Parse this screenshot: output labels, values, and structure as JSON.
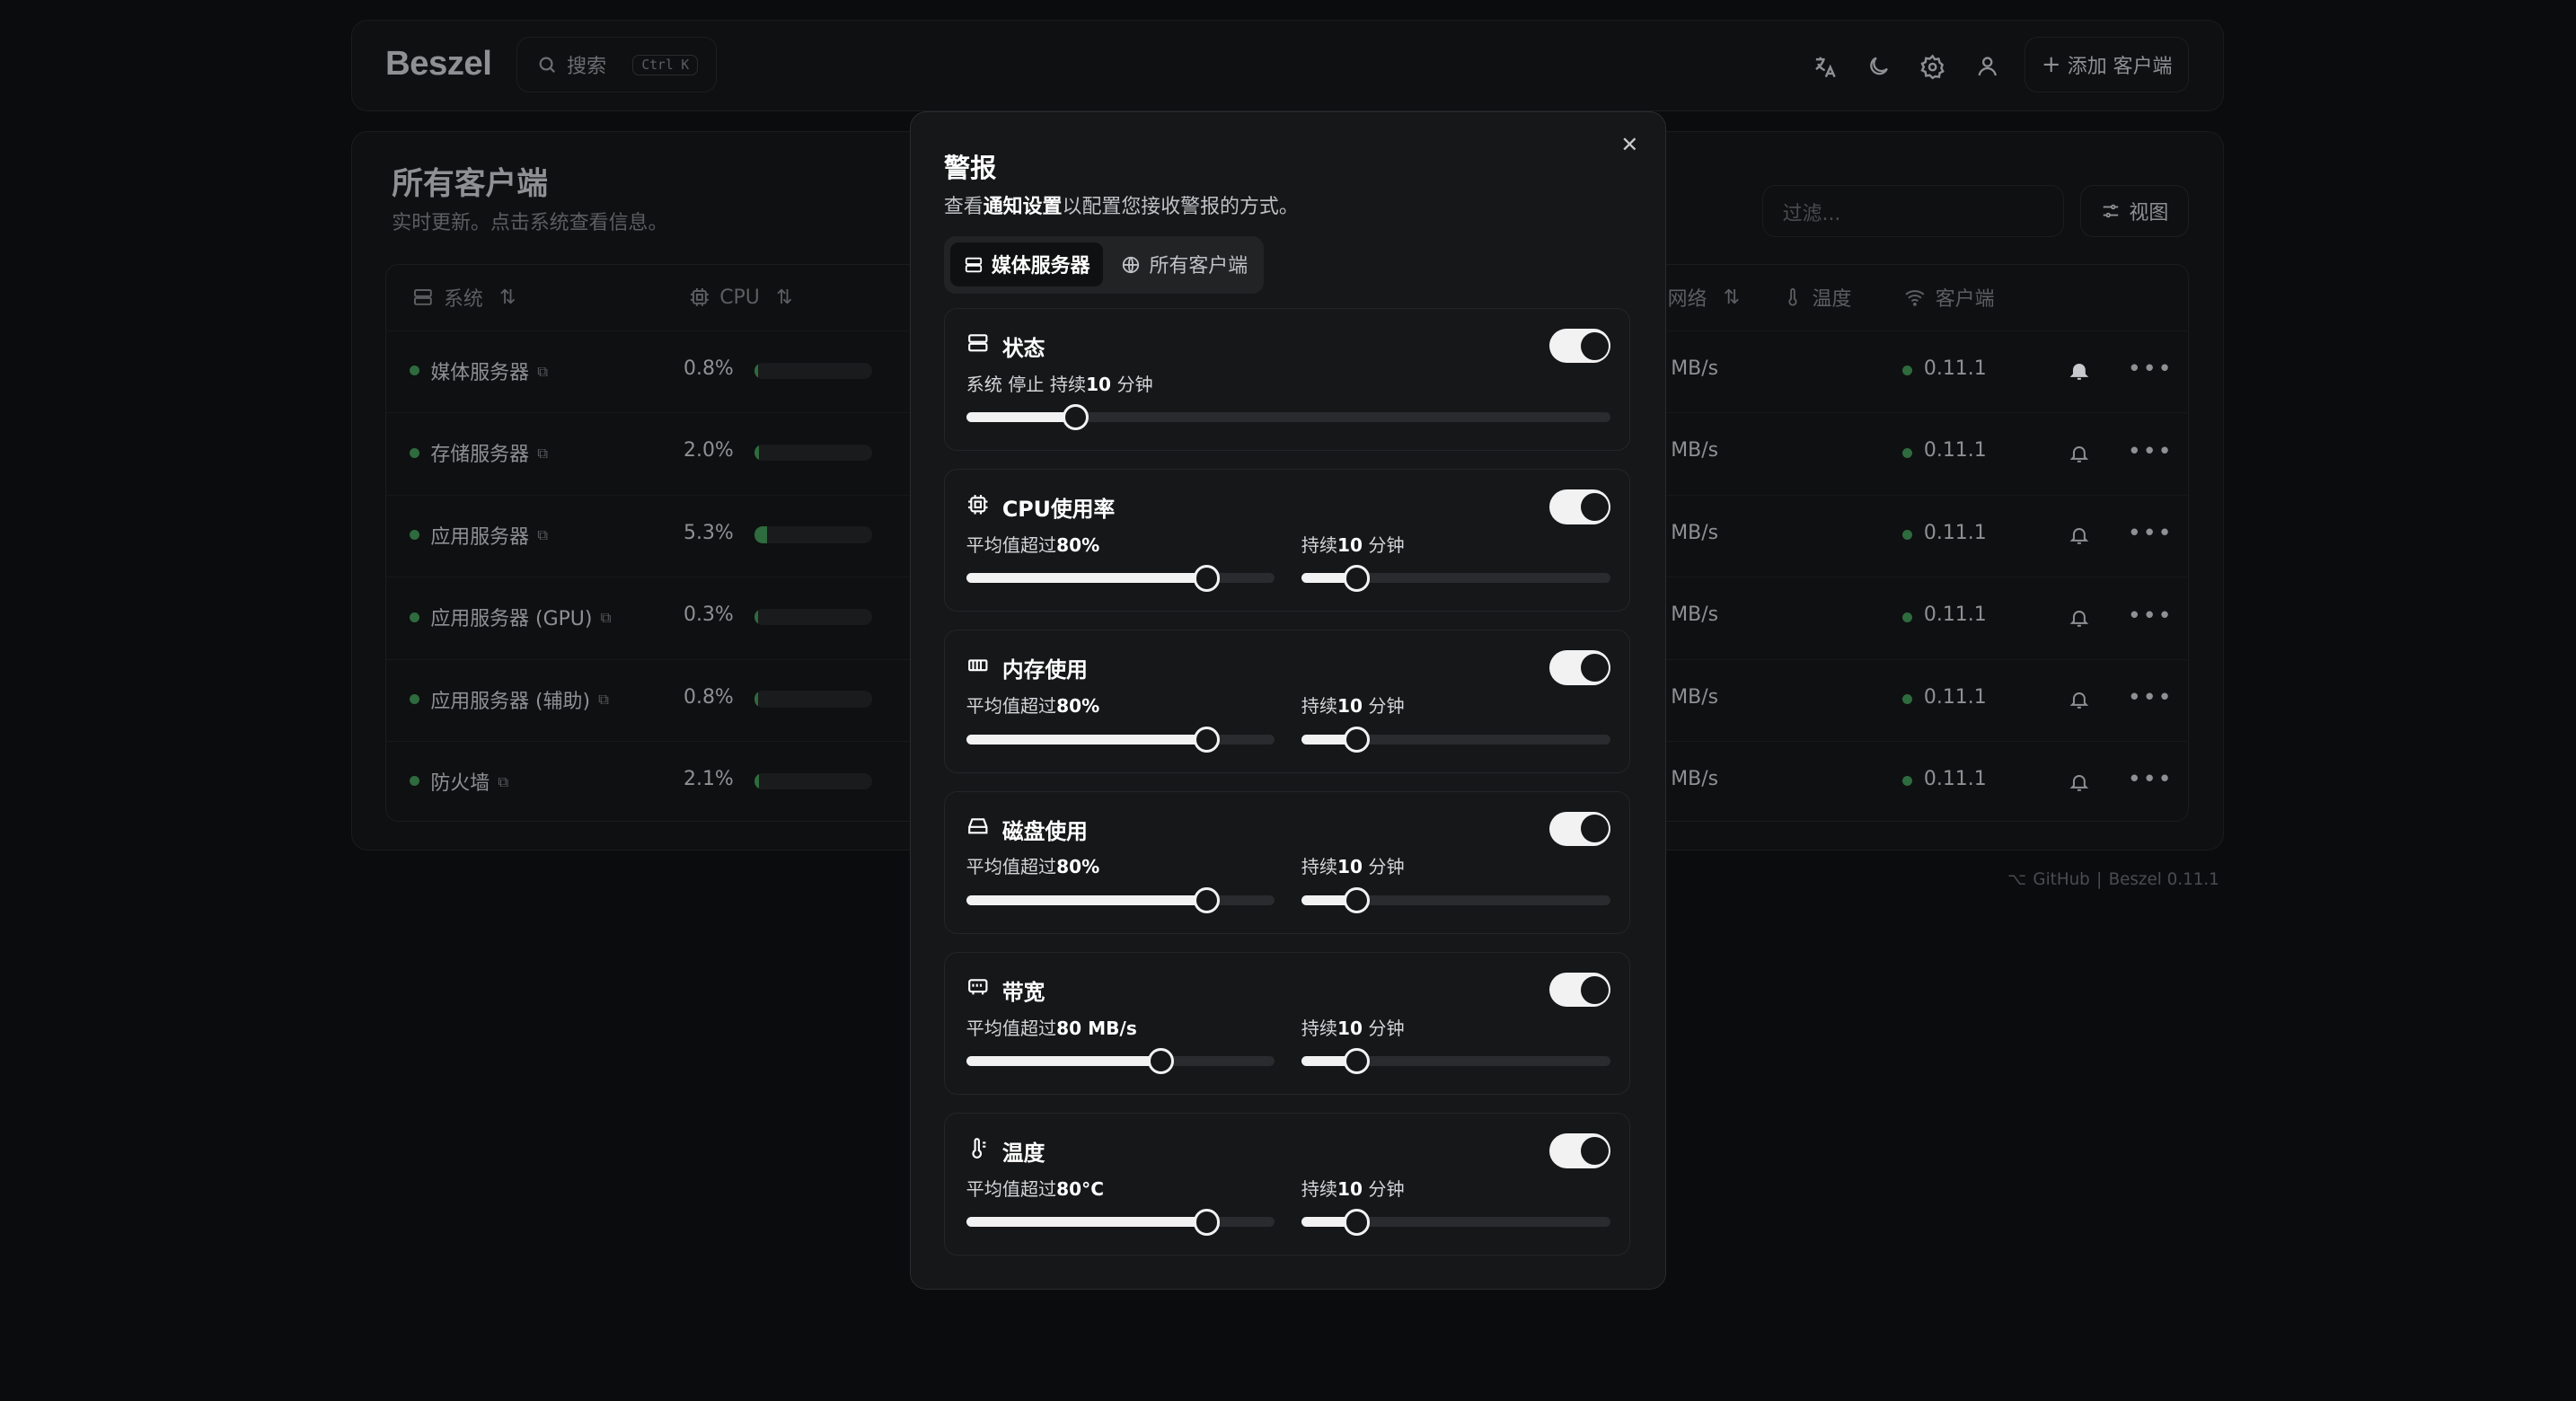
{
  "app": {
    "logo": "Beszel",
    "search_label": "搜索",
    "search_kbd": "Ctrl K",
    "add_label": "添加 客户端"
  },
  "page": {
    "title": "所有客户端",
    "subtitle": "实时更新。点击系统查看信息。",
    "filter_placeholder": "过滤...",
    "view_label": "视图"
  },
  "table": {
    "columns": {
      "system": "系统",
      "cpu": "CPU",
      "network": "网络",
      "temp": "温度",
      "client": "客户端"
    },
    "rows": [
      {
        "name": "媒体服务器",
        "cpu": "0.8%",
        "cpu_pct": 0.8,
        "net": "MB/s",
        "version": "0.11.1",
        "bell_active": true
      },
      {
        "name": "存储服务器",
        "cpu": "2.0%",
        "cpu_pct": 2.0,
        "net": "MB/s",
        "version": "0.11.1",
        "bell_active": false
      },
      {
        "name": "应用服务器",
        "cpu": "5.3%",
        "cpu_pct": 5.3,
        "net": "MB/s",
        "version": "0.11.1",
        "bell_active": false
      },
      {
        "name": "应用服务器 (GPU)",
        "cpu": "0.3%",
        "cpu_pct": 0.3,
        "net": "MB/s",
        "version": "0.11.1",
        "bell_active": false
      },
      {
        "name": "应用服务器 (辅助)",
        "cpu": "0.8%",
        "cpu_pct": 0.8,
        "net": "MB/s",
        "version": "0.11.1",
        "bell_active": false
      },
      {
        "name": "防火墙",
        "cpu": "2.1%",
        "cpu_pct": 2.1,
        "net": "MB/s",
        "version": "0.11.1",
        "bell_active": false
      }
    ]
  },
  "footer": {
    "github": "GitHub",
    "sep": "|",
    "version": "Beszel 0.11.1"
  },
  "modal": {
    "title": "警报",
    "sub_pre": "查看",
    "sub_link": "通知设置",
    "sub_post": "以配置您接收警报的方式。",
    "tabs": {
      "current": "媒体服务器",
      "all": "所有客户端"
    },
    "cards": [
      {
        "title": "状态",
        "enabled": true,
        "desc_pre": "系统 停止 持续",
        "desc_val": "10",
        "desc_post": " 分钟",
        "slider_pct": 17
      },
      {
        "title": "CPU使用率",
        "enabled": true,
        "th_pre": "平均值超过",
        "th_val": "80%",
        "th_pct": 78,
        "dur_pre": "持续",
        "dur_val": "10",
        "dur_post": " 分钟",
        "dur_pct": 18
      },
      {
        "title": "内存使用",
        "enabled": true,
        "th_pre": "平均值超过",
        "th_val": "80%",
        "th_pct": 78,
        "dur_pre": "持续",
        "dur_val": "10",
        "dur_post": " 分钟",
        "dur_pct": 18
      },
      {
        "title": "磁盘使用",
        "enabled": true,
        "th_pre": "平均值超过",
        "th_val": "80%",
        "th_pct": 78,
        "dur_pre": "持续",
        "dur_val": "10",
        "dur_post": " 分钟",
        "dur_pct": 18
      },
      {
        "title": "带宽",
        "enabled": true,
        "th_pre": "平均值超过",
        "th_val": "80 MB/s",
        "th_pct": 63,
        "dur_pre": "持续",
        "dur_val": "10",
        "dur_post": " 分钟",
        "dur_pct": 18
      },
      {
        "title": "温度",
        "enabled": true,
        "th_pre": "平均值超过",
        "th_val": "80°C",
        "th_pct": 78,
        "dur_pre": "持续",
        "dur_val": "10",
        "dur_post": " 分钟",
        "dur_pct": 18
      }
    ]
  },
  "colors": {
    "accent_green": "#2e6b3e",
    "modal_bg": "#161718",
    "page_bg": "#0b0c0d"
  }
}
